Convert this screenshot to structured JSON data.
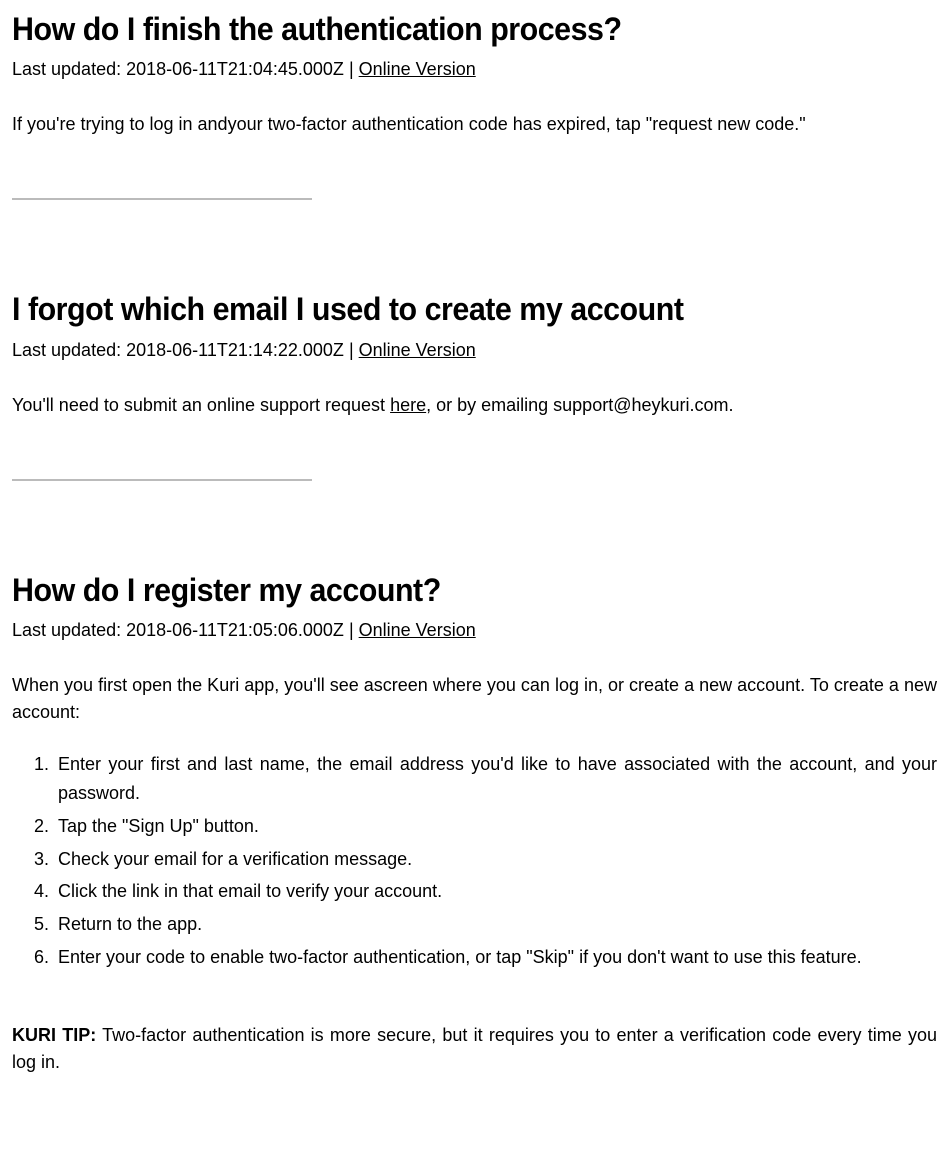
{
  "labels": {
    "last_updated_prefix": "Last updated: ",
    "online_version": "Online Version"
  },
  "articles": [
    {
      "title": "How do I finish the authentication process?",
      "updated": "2018-06-11T21:04:45.000Z",
      "body_prefix": "If you're trying to log in and",
      "body_suffix": "your two-factor authentication code has expired, tap \"request new code.\""
    },
    {
      "title": "I forgot which email I used to create my account",
      "updated": "2018-06-11T21:14:22.000Z",
      "body_prefix": "You'll need to submit",
      "body_mid": "an online support request",
      "link_text": "here",
      "body_suffix": ", or by emailing support@heykuri.com."
    },
    {
      "title": "How do I register my account?",
      "updated": "2018-06-11T21:05:06.000Z",
      "intro_prefix": "When you first open the Kuri app, you'll see a",
      "intro_suffix": "screen where you can log in, or create a new account. To create a new account:",
      "steps": [
        "Enter your first and last name, the email address you'd like to have associated with the account, and your password.",
        "Tap the \"Sign Up\" button.",
        "Check your email for a verification message.",
        "Click the link in that email to verify your account.",
        "Return to the app.",
        "Enter your code to enable two-factor authentication, or tap \"Skip\" if you don't want to use this feature."
      ],
      "tip_label": "KURI TIP:",
      "tip_body": "Two-factor authentication is more secure, but it requires you to enter a verification code every time you log in."
    }
  ]
}
